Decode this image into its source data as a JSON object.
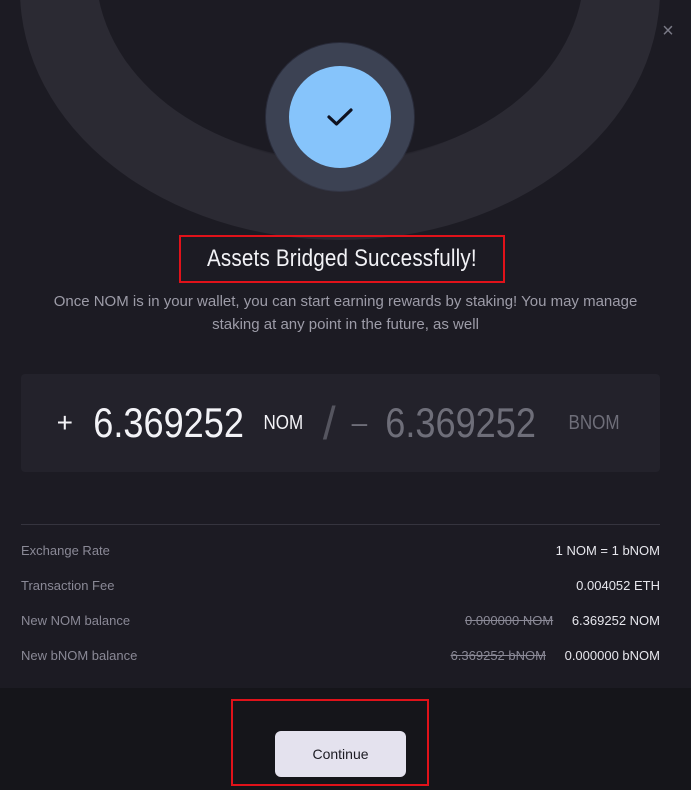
{
  "modal": {
    "close_glyph": "×",
    "title": "Assets Bridged Successfully!",
    "subtitle": "Once NOM is in your wallet, you can start earning rewards by staking! You may manage staking at any point in the future, as well"
  },
  "amounts": {
    "received_sign": "+",
    "received_value": "6.369252",
    "received_unit": "NOM",
    "separator": "/",
    "sent_sign": "–",
    "sent_value": "6.369252",
    "sent_unit": "BNOM"
  },
  "details": [
    {
      "label": "Exchange Rate",
      "old_value": "",
      "value": "1 NOM = 1 bNOM"
    },
    {
      "label": "Transaction Fee",
      "old_value": "",
      "value": "0.004052 ETH"
    },
    {
      "label": "New NOM balance",
      "old_value": "0.000000 NOM",
      "value": "6.369252 NOM"
    },
    {
      "label": "New bNOM balance",
      "old_value": "6.369252 bNOM",
      "value": "0.000000 bNOM"
    }
  ],
  "footer": {
    "continue_label": "Continue"
  },
  "colors": {
    "accent_check": "#86c4fb",
    "highlight_box": "#e0121a",
    "button_bg": "#e4e2ee"
  },
  "icons": {
    "success": "checkmark-icon",
    "close": "close-icon"
  }
}
